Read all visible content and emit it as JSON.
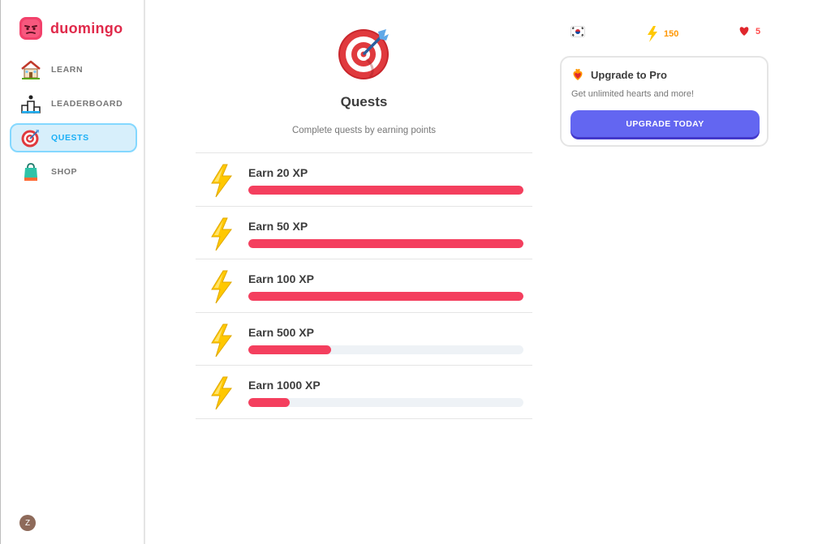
{
  "brand": {
    "name": "duomingo",
    "color": "#e0294a"
  },
  "sidebar": {
    "items": [
      {
        "label": "LEARN",
        "icon": "house-icon",
        "active": false
      },
      {
        "label": "LEADERBOARD",
        "icon": "podium-icon",
        "active": false
      },
      {
        "label": "QUESTS",
        "icon": "target-icon",
        "active": true
      },
      {
        "label": "SHOP",
        "icon": "shopping-bag-icon",
        "active": false
      }
    ],
    "avatar_initial": "Z"
  },
  "main": {
    "title": "Quests",
    "subtitle": "Complete quests by earning points",
    "quests": [
      {
        "title": "Earn 20 XP",
        "progress": 1.0
      },
      {
        "title": "Earn 50 XP",
        "progress": 1.0
      },
      {
        "title": "Earn 100 XP",
        "progress": 1.0
      },
      {
        "title": "Earn 500 XP",
        "progress": 0.3
      },
      {
        "title": "Earn 1000 XP",
        "progress": 0.15
      }
    ]
  },
  "stats": {
    "language_flag": "south-korea-flag-icon",
    "xp": "150",
    "hearts": "5"
  },
  "pro_card": {
    "title": "Upgrade to Pro",
    "text": "Get unlimited hearts and more!",
    "button_label": "UPGRADE TODAY"
  },
  "colors": {
    "accent": "#1cb0f6",
    "progress": "#f43f5e",
    "button": "#6366f1",
    "xp": "#ff9600",
    "hearts": "#ff4b4b"
  }
}
